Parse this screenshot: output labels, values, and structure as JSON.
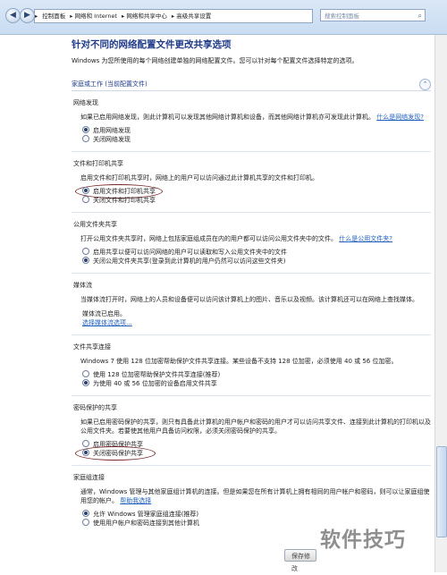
{
  "nav": {
    "back": "◀",
    "forward": "▶",
    "breadcrumb": [
      "控制面板",
      "网络和 Internet",
      "网络和共享中心",
      "高级共享设置"
    ],
    "search_placeholder": "搜索控制面板"
  },
  "page": {
    "title": "针对不同的网络配置文件更改共享选项",
    "intro": "Windows 为您所使用的每个网络创建单独的网络配置文件。您可以针对每个配置文件选择特定的选项。"
  },
  "profile": {
    "label": "家庭或工作 (当前配置文件)"
  },
  "sections": {
    "discovery": {
      "title": "网络发现",
      "desc": "如果已启用网络发现，则此计算机可以发现其他网络计算机和设备，而其他网络计算机亦可发现此计算机。",
      "link": "什么是网络发现?",
      "options": [
        "启用网络发现",
        "关闭网络发现"
      ]
    },
    "printer": {
      "title": "文件和打印机共享",
      "desc": "启用文件和打印机共享时，网络上的用户可以访问通过此计算机共享的文件和打印机。",
      "options": [
        "启用文件和打印机共享",
        "关闭文件和打印机共享"
      ]
    },
    "public": {
      "title": "公用文件夹共享",
      "desc": "打开公用文件夹共享时，网络上包括家庭组成员在内的用户都可以访问公用文件夹中的文件。",
      "link": "什么是公用文件夹?",
      "options": [
        "启用共享以便可以访问网络的用户可以读取和写入公用文件夹中的文件",
        "关闭公用文件夹共享(登录到此计算机的用户仍然可以访问这些文件夹)"
      ]
    },
    "media": {
      "title": "媒体流",
      "desc": "当媒体流打开时，网络上的人员和设备便可以访问该计算机上的图片、音乐以及视频。该计算机还可以在网络上查找媒体。",
      "status": "媒体流已启用。",
      "link": "选择媒体流选项..."
    },
    "connection": {
      "title": "文件共享连接",
      "desc": "Windows 7 使用 128 位加密帮助保护文件共享连接。某些设备不支持 128 位加密，必须使用 40 或 56 位加密。",
      "options": [
        "使用 128 位加密帮助保护文件共享连接(推荐)",
        "为使用 40 或 56 位加密的设备启用文件共享"
      ]
    },
    "password": {
      "title": "密码保护的共享",
      "desc": "如果已启用密码保护的共享，则只有具备此计算机的用户帐户和密码的用户才可以访问共享文件、连接到此计算机的打印机以及公用文件夹。若要使其他用户具备访问权限，必须关闭密码保护的共享。",
      "options": [
        "启用密码保护共享",
        "关闭密码保护共享"
      ]
    },
    "homegroup": {
      "title": "家庭组连接",
      "desc": "通常，Windows 管理与其他家庭组计算机的连接。但是如果您在所有计算机上拥有相同的用户帐户和密码，则可以让家庭组使用您的帐户。",
      "link": "帮助我选择",
      "options": [
        "允许 Windows 管理家庭组连接(推荐)",
        "使用用户帐户和密码连接到其他计算机"
      ]
    }
  },
  "buttons": {
    "save": "保存修改"
  },
  "watermark": "软件技巧"
}
